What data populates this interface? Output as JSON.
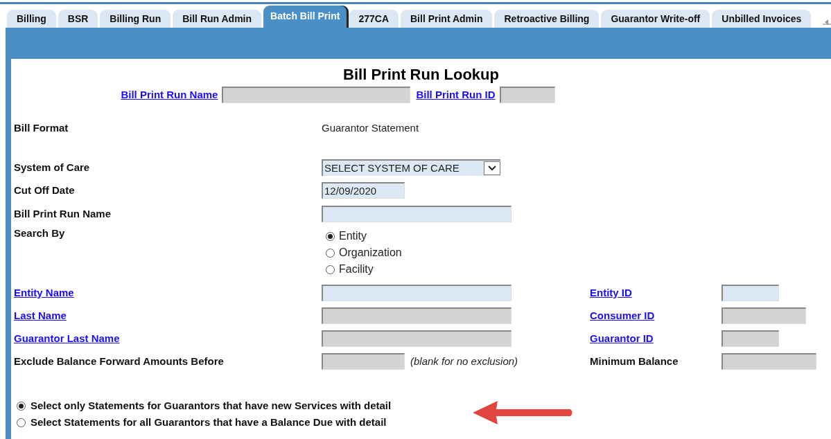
{
  "tabs": [
    {
      "label": "Billing",
      "selected": false
    },
    {
      "label": "BSR",
      "selected": false
    },
    {
      "label": "Billing Run",
      "selected": false
    },
    {
      "label": "Bill Run Admin",
      "selected": false
    },
    {
      "label": "Batch Bill Print",
      "selected": true
    },
    {
      "label": "277CA",
      "selected": false
    },
    {
      "label": "Bill Print Admin",
      "selected": false
    },
    {
      "label": "Retroactive Billing",
      "selected": false
    },
    {
      "label": "Guarantor Write-off",
      "selected": false
    },
    {
      "label": "Unbilled Invoices",
      "selected": false
    }
  ],
  "title": "Bill Print Run Lookup",
  "lookup": [
    {
      "label": "Bill Print Run Name",
      "disabled": true
    },
    {
      "label": "Bill Print Run ID",
      "disabled": true
    }
  ],
  "rows": [
    {
      "kind": "static",
      "label": "Bill Format",
      "link": false,
      "value": "Guarantor Statement"
    },
    {
      "kind": "select",
      "label": "System of Care",
      "link": false,
      "value": "SELECT SYSTEM OF CARE"
    },
    {
      "kind": "input",
      "label": "Cut Off Date",
      "link": false,
      "value": "12/09/2020",
      "disabled": false
    },
    {
      "kind": "input",
      "label": "Bill Print Run Name",
      "link": false,
      "disabled": false
    },
    {
      "kind": "radios",
      "label": "Search By",
      "link": false,
      "options": [
        {
          "label": "Entity",
          "selected": true
        },
        {
          "label": "Organization",
          "selected": false
        },
        {
          "label": "Facility",
          "selected": false
        }
      ]
    },
    {
      "kind": "input",
      "label": "Entity Name",
      "link": true,
      "disabled": false,
      "side": {
        "label": "Entity ID",
        "link": true,
        "disabled": false
      }
    },
    {
      "kind": "input",
      "label": "Last Name",
      "link": true,
      "disabled": true,
      "side": {
        "label": "Consumer ID",
        "link": true,
        "disabled": true
      }
    },
    {
      "kind": "input",
      "label": "Guarantor Last Name",
      "link": true,
      "disabled": true,
      "side": {
        "label": "Guarantor ID",
        "link": true,
        "disabled": true
      }
    },
    {
      "kind": "input",
      "label": "Exclude Balance Forward Amounts Before",
      "link": false,
      "disabled": true,
      "note": "(blank for no exclusion)",
      "side": {
        "label": "Minimum Balance",
        "link": false,
        "disabled": true
      }
    }
  ],
  "statement_options": [
    {
      "label": "Select only Statements for Guarantors that have new Services with detail",
      "selected": true
    },
    {
      "label": "Select Statements for all Guarantors that have a Balance Due with detail",
      "selected": false
    }
  ]
}
